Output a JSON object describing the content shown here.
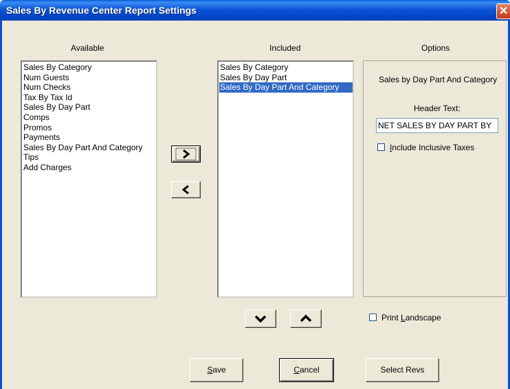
{
  "window": {
    "title": "Sales By Revenue Center Report Settings",
    "close_glyph": "✕"
  },
  "available": {
    "label": "Available",
    "items": [
      "Sales By Category",
      "Num Guests",
      "Num Checks",
      "Tax By Tax Id",
      "Sales By Day Part",
      "Comps",
      "Promos",
      "Payments",
      "Sales By Day Part And Category",
      "Tips",
      "Add Charges"
    ]
  },
  "included": {
    "label": "Included",
    "items": [
      "Sales By Category",
      "Sales By Day Part",
      "Sales By Day Part And Category"
    ],
    "selected_index": 2
  },
  "move": {
    "add_glyph": ">",
    "remove_glyph": "<",
    "down_glyph": "⌄",
    "up_glyph": "⌃"
  },
  "options": {
    "label": "Options",
    "section_title": "Sales by Day Part And Category",
    "header_text_label": "Header Text:",
    "header_text_value": "NET SALES BY DAY PART BY",
    "include_taxes_prefix": "",
    "include_taxes_key": "I",
    "include_taxes_rest": "nclude Inclusive Taxes",
    "include_taxes_checked": false
  },
  "print_landscape": {
    "prefix": "Print ",
    "key": "L",
    "rest": "andscape",
    "checked": false
  },
  "buttons": {
    "save_key": "S",
    "save_rest": "ave",
    "cancel_key": "C",
    "cancel_rest": "ancel",
    "select_revs": "Select Revs"
  },
  "icons": {
    "down": "chevron-down-icon",
    "up": "chevron-up-icon",
    "add": "chevron-right-icon",
    "remove": "chevron-left-icon"
  }
}
